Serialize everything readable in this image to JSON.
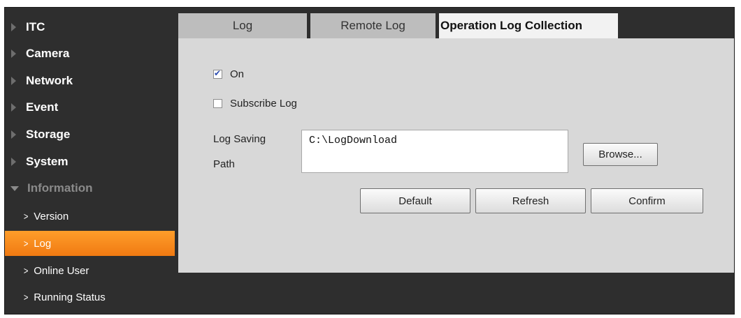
{
  "sidebar": {
    "menu": [
      {
        "label": "ITC"
      },
      {
        "label": "Camera"
      },
      {
        "label": "Network"
      },
      {
        "label": "Event"
      },
      {
        "label": "Storage"
      },
      {
        "label": "System"
      },
      {
        "label": "Information"
      }
    ],
    "submenu": [
      {
        "label": "Version"
      },
      {
        "label": "Log"
      },
      {
        "label": "Online User"
      },
      {
        "label": "Running Status"
      }
    ],
    "active_item": "Log",
    "colors": {
      "background": "#2e2e2e",
      "active": "#f5891c"
    }
  },
  "tabs": [
    {
      "label": "Log"
    },
    {
      "label": "Remote Log"
    },
    {
      "label": "Operation Log Collection"
    }
  ],
  "active_tab": "Operation Log Collection",
  "form": {
    "on": {
      "label": "On",
      "checked": true
    },
    "subscribe": {
      "label": "Subscribe Log",
      "checked": false
    },
    "path_label_line1": "Log Saving",
    "path_label_line2": "Path",
    "path_value": "C:\\LogDownload",
    "browse_label": "Browse..."
  },
  "buttons": {
    "default": "Default",
    "refresh": "Refresh",
    "confirm": "Confirm"
  }
}
